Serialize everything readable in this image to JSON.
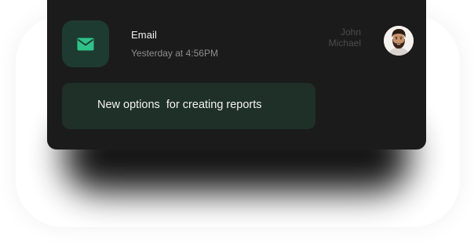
{
  "notification": {
    "app_name": "Email",
    "timestamp": "Yesterday at 4:56PM",
    "sender_first": "John",
    "sender_last": "Michael",
    "message": "New options  for creating reports",
    "icon": "mail-icon",
    "avatar": "user-avatar"
  },
  "colors": {
    "card_bg": "#1b1b1b",
    "app_tile_bg": "#1e3b31",
    "icon_accent": "#2fc389",
    "message_bg": "#1f3028",
    "timestamp": "#8e8e8e",
    "sender": "#4d4d4d"
  }
}
